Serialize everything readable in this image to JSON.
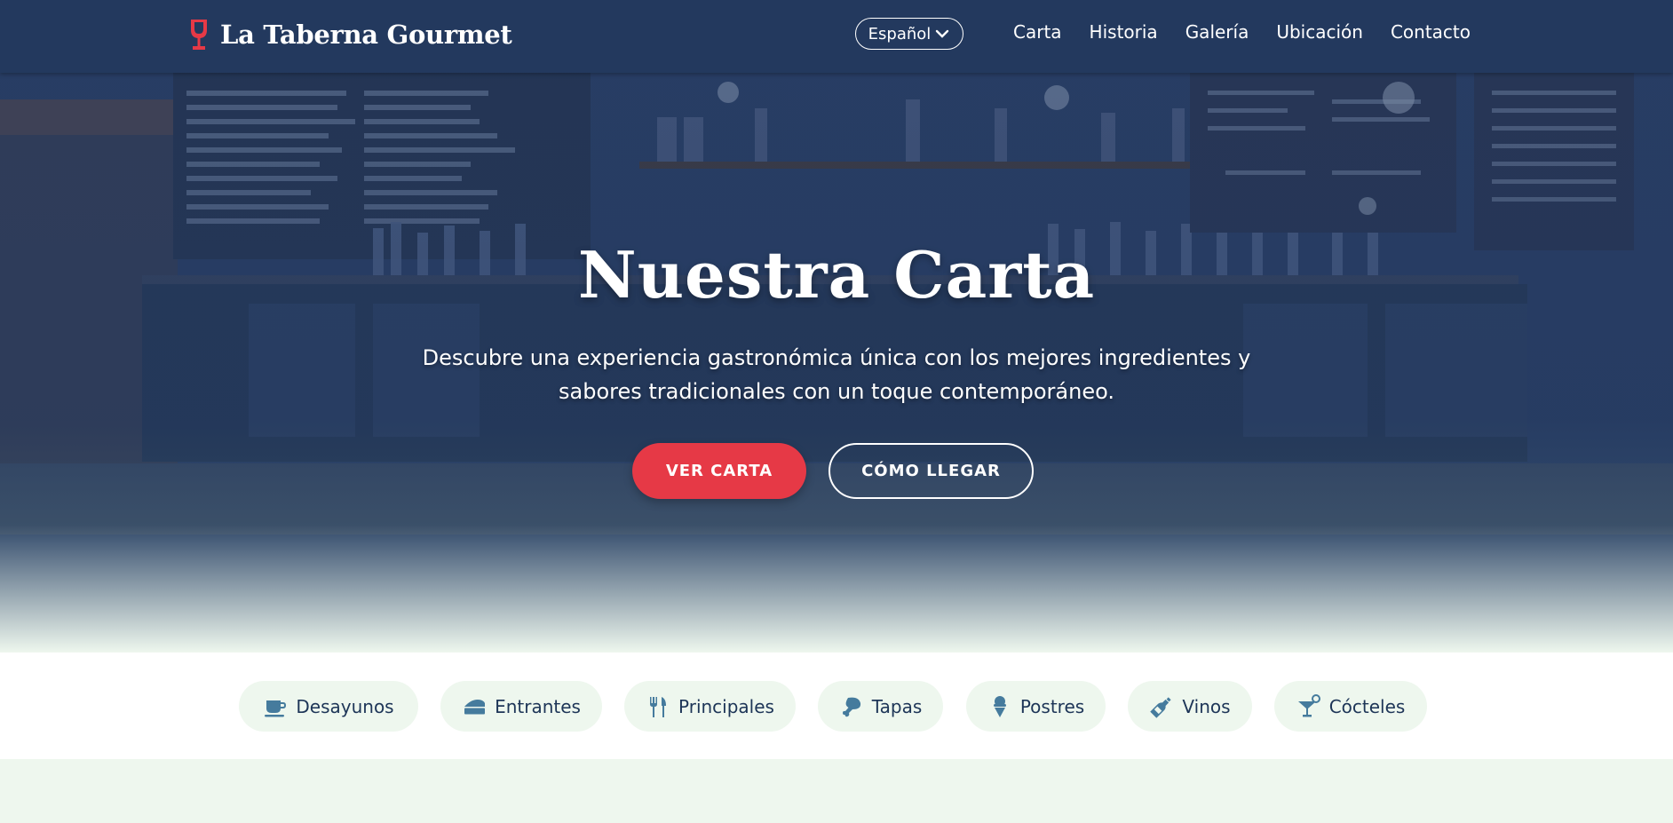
{
  "brand": {
    "name": "La Taberna Gourmet",
    "icon": "wine-glass-icon"
  },
  "language": {
    "selected": "Español",
    "icon": "chevron-down-icon"
  },
  "nav": {
    "links": [
      "Carta",
      "Historia",
      "Galería",
      "Ubicación",
      "Contacto"
    ]
  },
  "hero": {
    "title": "Nuestra Carta",
    "subtitle": "Descubre una experiencia gastronómica única con los mejores ingredientes y sabores tradicionales con un toque contemporáneo.",
    "primary_button": "VER CARTA",
    "secondary_button": "CÓMO LLEGAR"
  },
  "categories": [
    {
      "label": "Desayunos",
      "icon": "coffee-cup-icon"
    },
    {
      "label": "Entrantes",
      "icon": "cheese-icon"
    },
    {
      "label": "Principales",
      "icon": "utensils-icon"
    },
    {
      "label": "Tapas",
      "icon": "drumstick-icon"
    },
    {
      "label": "Postres",
      "icon": "ice-cream-icon"
    },
    {
      "label": "Vinos",
      "icon": "wine-bottle-icon"
    },
    {
      "label": "Cócteles",
      "icon": "cocktail-icon"
    }
  ],
  "colors": {
    "navbar": "#23395e",
    "accent": "#e63946",
    "chip_bg": "#eef7ee",
    "icon": "#457b9d"
  }
}
